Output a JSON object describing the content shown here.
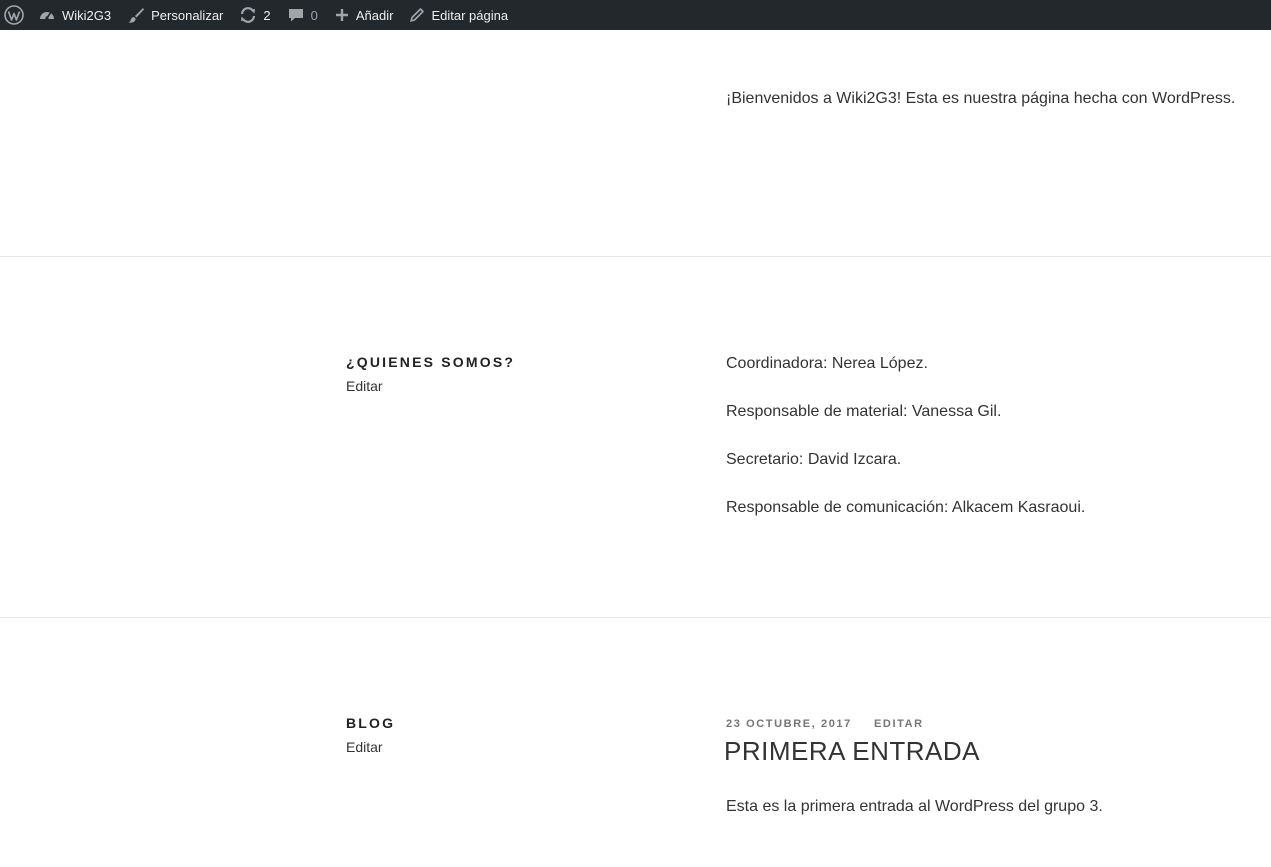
{
  "adminbar": {
    "site_name": "Wiki2G3",
    "customize_label": "Personalizar",
    "updates_count": "2",
    "comments_count": "0",
    "add_label": "Añadir",
    "edit_page_label": "Editar página",
    "background_color": "#23282d"
  },
  "intro": {
    "text": "¡Bienvenidos a Wiki2G3! Esta es nuestra página hecha con WordPress."
  },
  "about": {
    "title": "¿QUIENES SOMOS?",
    "edit_label": "Editar",
    "members": [
      "Coordinadora: Nerea López.",
      "Responsable de material: Vanessa Gil.",
      "Secretario: David Izcara.",
      "Responsable de comunicación: Alkacem Kasraoui."
    ]
  },
  "blog": {
    "title": "BLOG",
    "edit_label": "Editar",
    "post": {
      "date": "23 OCTUBRE, 2017",
      "edit_label": "EDITAR",
      "title": "PRIMERA ENTRADA",
      "excerpt": "Esta es la primera entrada al WordPress del grupo 3."
    }
  }
}
